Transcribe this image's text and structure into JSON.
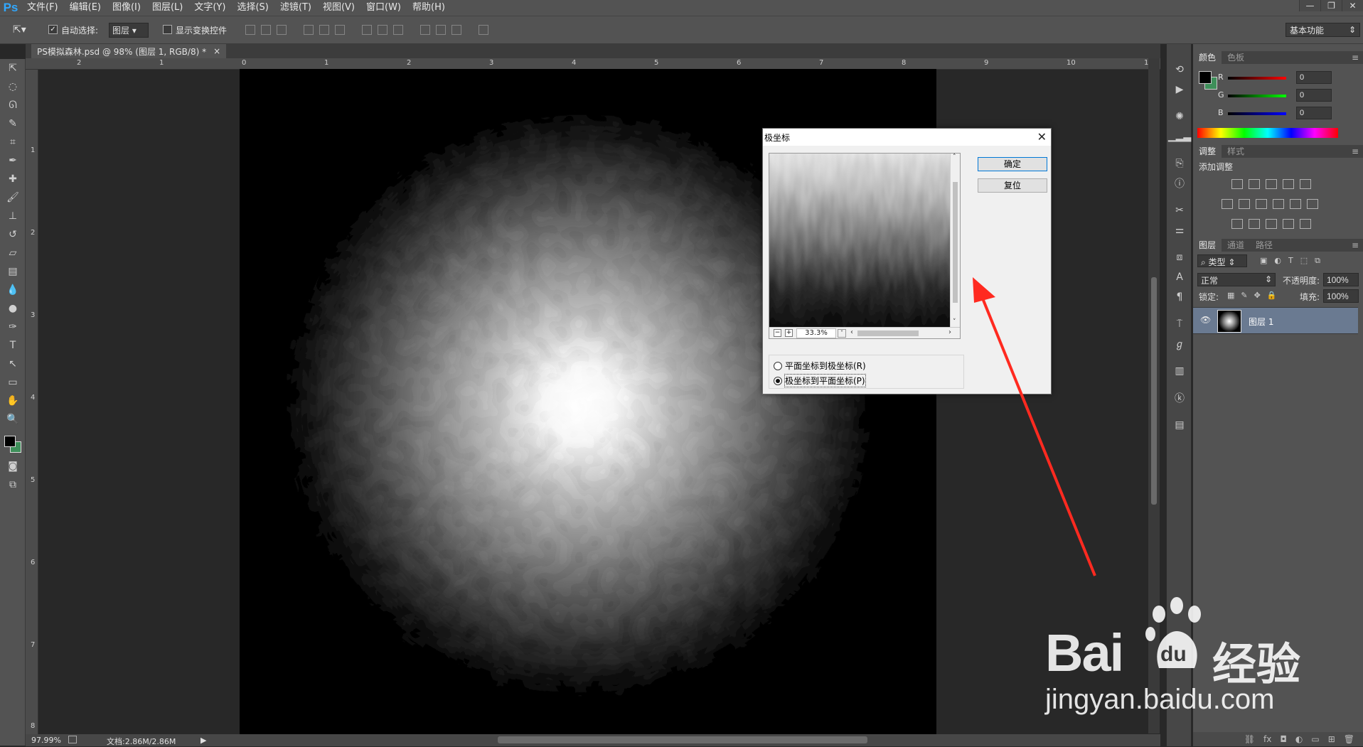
{
  "app": {
    "logo": "Ps"
  },
  "menu": [
    "文件(F)",
    "编辑(E)",
    "图像(I)",
    "图层(L)",
    "文字(Y)",
    "选择(S)",
    "滤镜(T)",
    "视图(V)",
    "窗口(W)",
    "帮助(H)"
  ],
  "window_controls": [
    "—",
    "❐",
    "✕"
  ],
  "options": {
    "move_tool_icon": "move-arrow",
    "auto_select_label": "自动选择:",
    "auto_select_checked": true,
    "auto_select_value": "图层",
    "show_transform_label": "显示变换控件",
    "show_transform_checked": false,
    "workspace": "基本功能"
  },
  "document": {
    "tab_title": "PS模拟森林.psd @ 98% (图层 1, RGB/8) *",
    "tab_close": "×",
    "ruler_h": [
      "2",
      "1",
      "0",
      "1",
      "2",
      "3",
      "4",
      "5",
      "6",
      "7",
      "8",
      "9",
      "10",
      "1"
    ],
    "ruler_v": [
      "1",
      "2",
      "3",
      "4",
      "5",
      "6",
      "7",
      "8"
    ]
  },
  "status": {
    "zoom": "97.99%",
    "doc": "文档:2.86M/2.86M",
    "arrow": "▶"
  },
  "color_panel": {
    "tabs": [
      "颜色",
      "色板"
    ],
    "channels": [
      {
        "label": "R",
        "value": "0"
      },
      {
        "label": "G",
        "value": "0"
      },
      {
        "label": "B",
        "value": "0"
      }
    ],
    "fg": "#000000",
    "bg": "#3e8f5a"
  },
  "adjust_panel": {
    "tabs": [
      "调整",
      "样式"
    ],
    "title": "添加调整"
  },
  "layers_panel": {
    "tabs": [
      "图层",
      "通道",
      "路径"
    ],
    "filter_kind": "类型",
    "blend_mode": "正常",
    "opacity_label": "不透明度:",
    "opacity": "100%",
    "lock_label": "锁定:",
    "fill_label": "填充:",
    "fill": "100%",
    "layers": [
      {
        "name": "图层 1",
        "visible": true
      }
    ]
  },
  "dialog": {
    "title": "极坐标",
    "close": "✕",
    "ok": "确定",
    "reset": "复位",
    "zoom_value": "33.3%",
    "zoom_minus": "−",
    "zoom_plus": "+",
    "options": [
      {
        "label": "平面坐标到极坐标(R)",
        "selected": false
      },
      {
        "label": "极坐标到平面坐标(P)",
        "selected": true
      }
    ]
  },
  "watermark": {
    "brand": "Bai",
    "paw": "du",
    "cn": "经验",
    "url": "jingyan.baidu.com"
  },
  "toolbox_icons": [
    "move-icon",
    "marquee-icon",
    "lasso-icon",
    "quick-select-icon",
    "crop-icon",
    "eyedropper-icon",
    "healing-icon",
    "brush-icon",
    "stamp-icon",
    "history-brush-icon",
    "eraser-icon",
    "gradient-icon",
    "blur-icon",
    "dodge-icon",
    "pen-icon",
    "type-icon",
    "path-select-icon",
    "shape-icon",
    "hand-icon",
    "zoom-icon"
  ],
  "colors": {
    "accent": "#31a8ff",
    "arrow": "#ff2a20"
  }
}
